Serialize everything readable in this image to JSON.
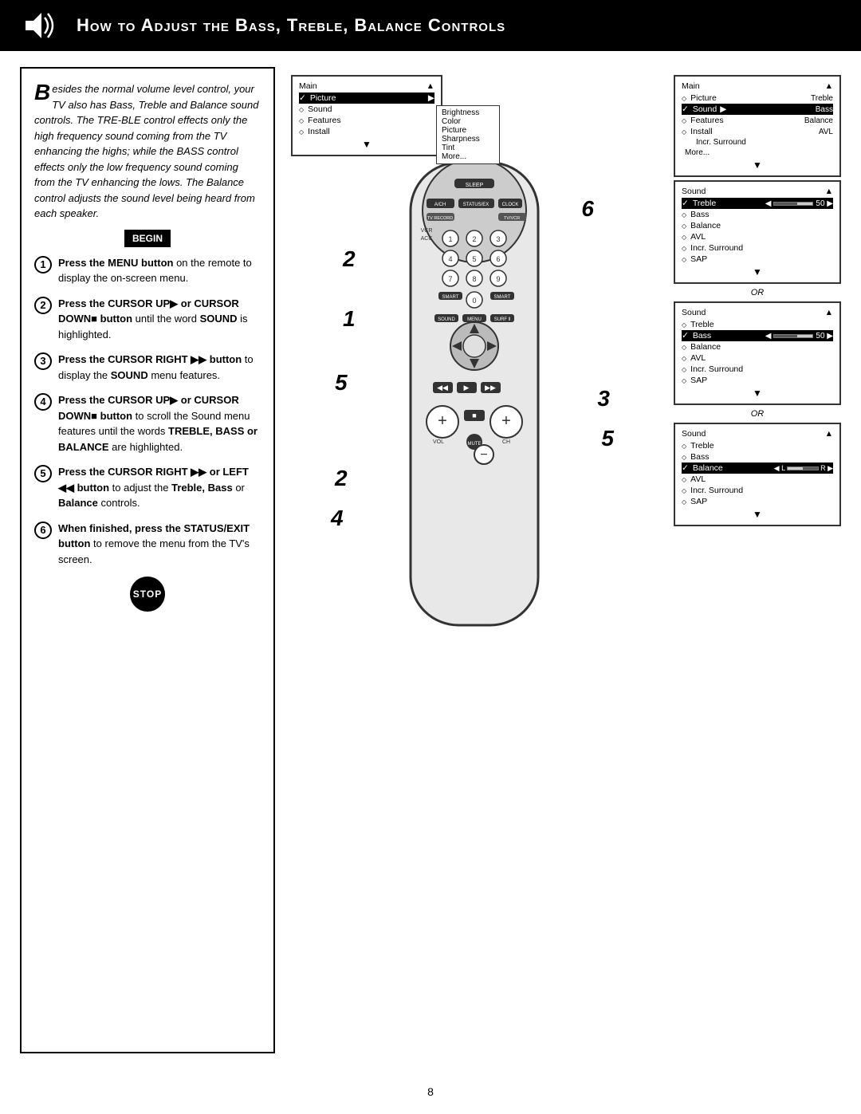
{
  "header": {
    "title": "How to Adjust the Bass, Treble, Balance Controls",
    "icon": "speaker"
  },
  "intro": {
    "text": "esides the normal volume level control, your TV also has Bass, Treble and Balance sound controls. The TREBLE control effects only the high frequency sound coming from the TV enhancing the highs; while the BASS control effects only the low frequency sound coming from the TV enhancing the lows. The Balance control adjusts the sound level being heard from each speaker.",
    "dropCap": "B"
  },
  "begin_label": "BEGIN",
  "stop_label": "STOP",
  "steps": [
    {
      "number": "1",
      "text": "Press the MENU button on the remote to display the on-screen menu."
    },
    {
      "number": "2",
      "text": "Press the CURSOR UP or CURSOR DOWN button until the word SOUND is highlighted."
    },
    {
      "number": "3",
      "text": "Press the CURSOR RIGHT button to display the SOUND menu features."
    },
    {
      "number": "4",
      "text": "Press the CURSOR UP or CURSOR DOWN button to scroll the Sound menu features until the words TREBLE, BASS or BALANCE are highlighted."
    },
    {
      "number": "5",
      "text": "Press the CURSOR RIGHT or LEFT button to adjust the Treble, Bass or Balance controls."
    },
    {
      "number": "6",
      "text": "When finished, press the STATUS/EXIT button to remove the menu from the TV's screen."
    }
  ],
  "main_menu": {
    "title": "Main",
    "items": [
      {
        "label": "Picture",
        "type": "check",
        "sub": "Brightness"
      },
      {
        "label": "Sound",
        "type": "diamond",
        "sub": "Color"
      },
      {
        "label": "Features",
        "type": "diamond",
        "sub": "Picture"
      },
      {
        "label": "Install",
        "type": "diamond",
        "sub": "Sharpness"
      },
      {
        "label": "",
        "sub": "Tint"
      },
      {
        "label": "",
        "sub": "More..."
      }
    ]
  },
  "menu2": {
    "title": "Main",
    "items": [
      {
        "label": "Picture",
        "type": "diamond",
        "value": "Treble"
      },
      {
        "label": "Sound",
        "type": "check-selected",
        "value": "Bass"
      },
      {
        "label": "Features",
        "type": "diamond",
        "value": "Balance"
      },
      {
        "label": "Install",
        "type": "diamond",
        "value": "AVL"
      },
      {
        "label": "",
        "value": "Incr. Surround"
      },
      {
        "label": "More...",
        "value": ""
      }
    ]
  },
  "sound_menu_treble": {
    "title": "Sound",
    "items": [
      {
        "label": "Treble",
        "type": "check-selected",
        "value": "50"
      },
      {
        "label": "Bass",
        "type": "diamond"
      },
      {
        "label": "Balance",
        "type": "diamond"
      },
      {
        "label": "AVL",
        "type": "diamond"
      },
      {
        "label": "Incr. Surround",
        "type": "diamond"
      },
      {
        "label": "SAP",
        "type": "diamond"
      }
    ],
    "or_after": true
  },
  "sound_menu_bass": {
    "title": "Sound",
    "items": [
      {
        "label": "Treble",
        "type": "diamond"
      },
      {
        "label": "Bass",
        "type": "check-selected",
        "value": "50"
      },
      {
        "label": "Balance",
        "type": "diamond"
      },
      {
        "label": "AVL",
        "type": "diamond"
      },
      {
        "label": "Incr. Surround",
        "type": "diamond"
      },
      {
        "label": "SAP",
        "type": "diamond"
      }
    ],
    "or_after": true
  },
  "sound_menu_balance": {
    "title": "Sound",
    "items": [
      {
        "label": "Treble",
        "type": "diamond"
      },
      {
        "label": "Bass",
        "type": "diamond"
      },
      {
        "label": "Balance",
        "type": "check-selected",
        "value": "L...R"
      },
      {
        "label": "AVL",
        "type": "diamond"
      },
      {
        "label": "Incr. Surround",
        "type": "diamond"
      },
      {
        "label": "SAP",
        "type": "diamond"
      }
    ]
  },
  "page_number": "8"
}
